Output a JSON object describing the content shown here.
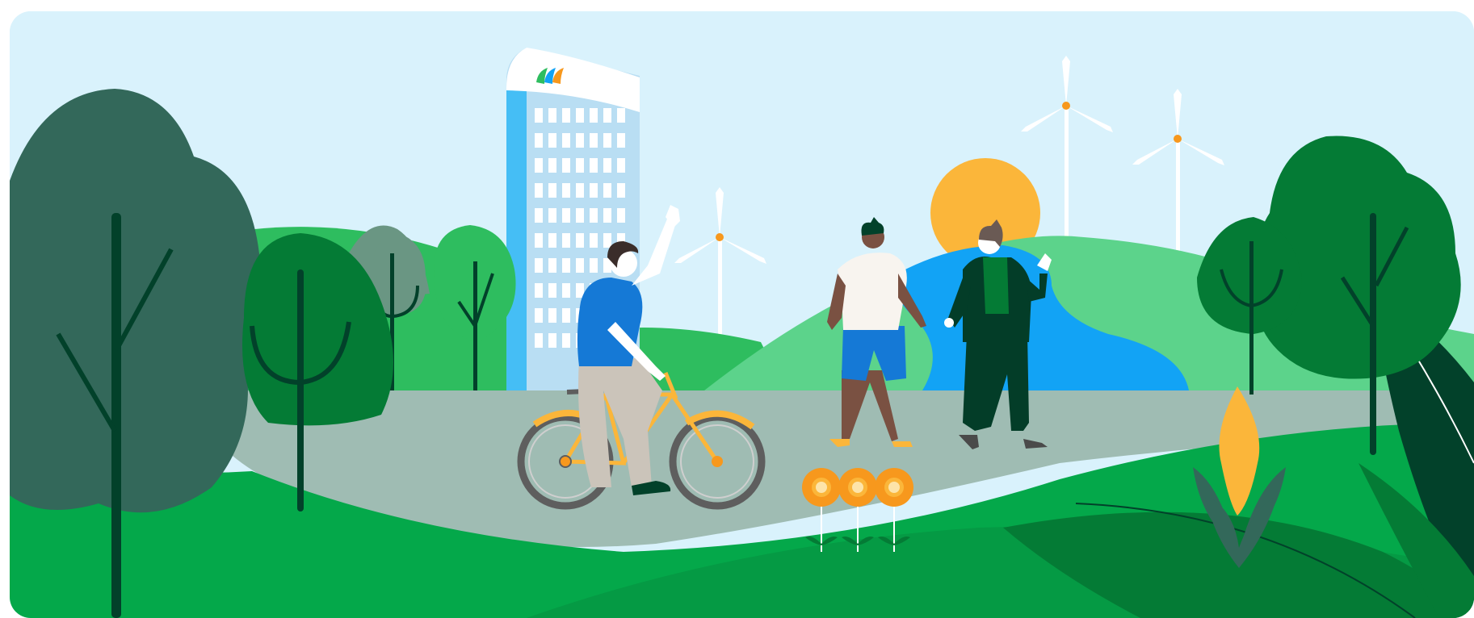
{
  "scene": {
    "colors": {
      "sky": "#d9f2fc",
      "sun": "#fbb63a",
      "grass_bright": "#04a84a",
      "grass_mid": "#2ebd5f",
      "grass_light": "#5cd38b",
      "hill_teal": "#6a9683",
      "path": "#9fbcb3",
      "tree_dark": "#33685a",
      "tree_green": "#047b35",
      "trunk": "#02412a",
      "water": "#12a3f5",
      "building_blue": "#b9def3",
      "building_side": "#45bef5",
      "flower": "#f7981d",
      "turbine": "#ffffff"
    },
    "icons": {
      "logo": "leaf-logo-icon",
      "turbines": "wind-turbine-icon",
      "flowers": "flower-icon"
    }
  }
}
